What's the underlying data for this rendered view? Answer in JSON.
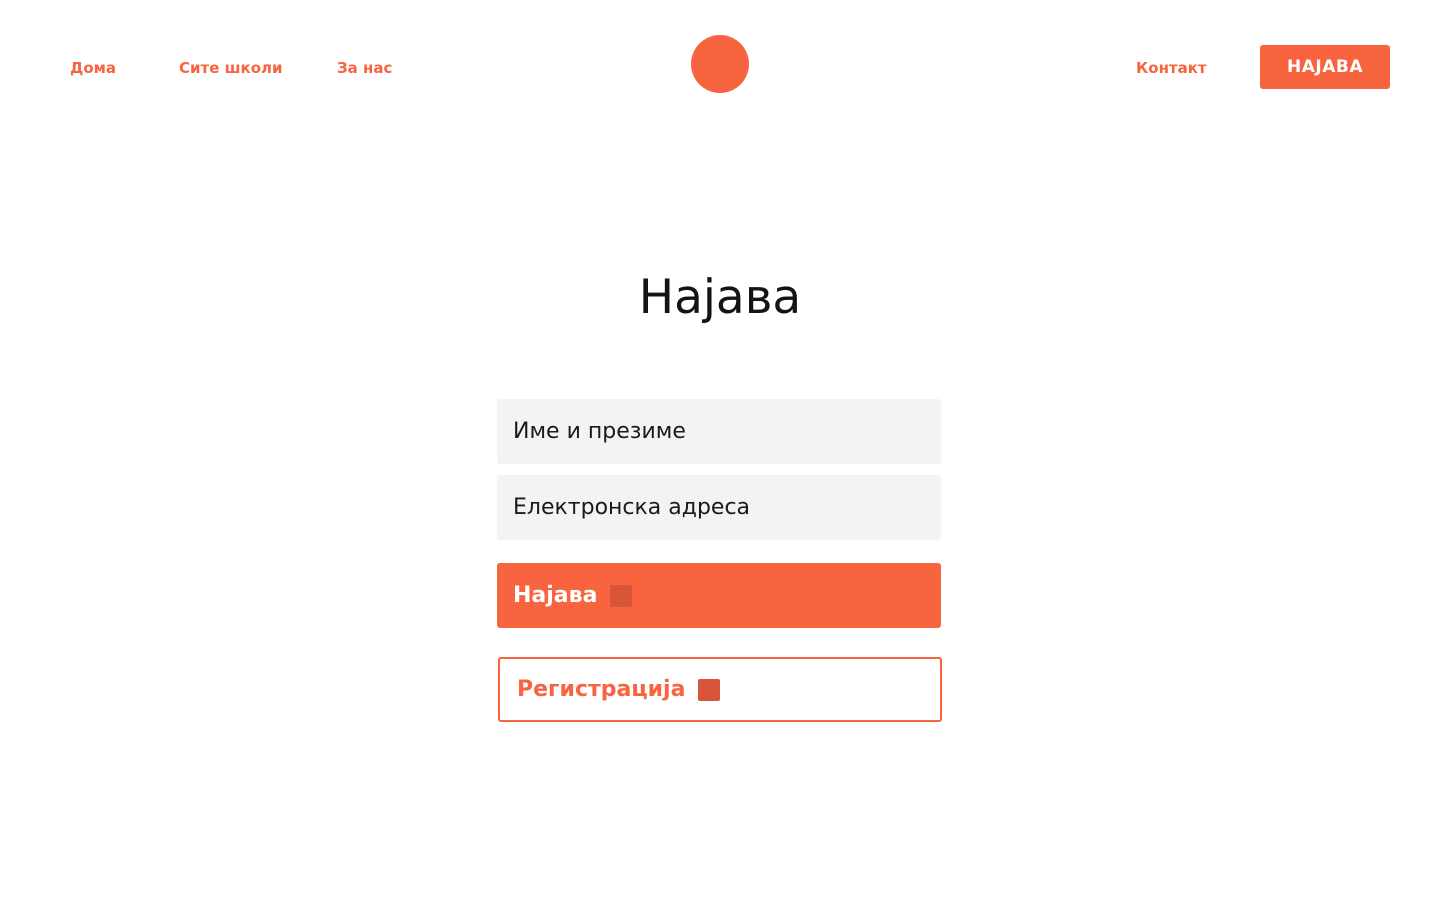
{
  "header": {
    "nav_left": {
      "home": "Дома",
      "schools": "Сите школи",
      "about": "За нас"
    },
    "logo_icon": "orange-circle-logo",
    "nav_right": {
      "contact": "Контакт",
      "login_button": "НАЈАВА"
    }
  },
  "main": {
    "title": "Најава",
    "form": {
      "name_placeholder": "Име и презиме",
      "email_placeholder": "Електронска адреса",
      "login_button": "Најава",
      "register_button": "Регистрација",
      "button_icon": "arrow-icon"
    }
  },
  "colors": {
    "accent": "#f7643f",
    "icon_square": "#d9553a",
    "field_background": "#f3f3f3",
    "title_text": "#141414"
  }
}
